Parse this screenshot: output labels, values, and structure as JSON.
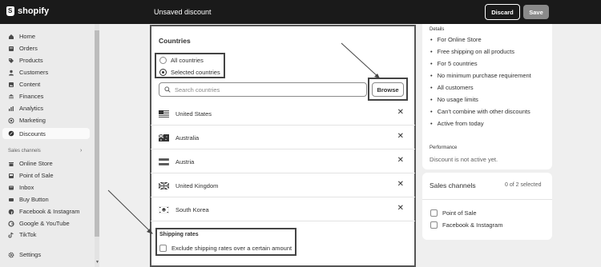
{
  "header": {
    "brand": "shopify",
    "page_title": "Unsaved discount",
    "discard_label": "Discard",
    "save_label": "Save"
  },
  "sidebar": {
    "items": [
      {
        "label": "Home",
        "icon": "home-icon"
      },
      {
        "label": "Orders",
        "icon": "orders-icon"
      },
      {
        "label": "Products",
        "icon": "tag-icon"
      },
      {
        "label": "Customers",
        "icon": "person-icon"
      },
      {
        "label": "Content",
        "icon": "content-icon"
      },
      {
        "label": "Finances",
        "icon": "bank-icon"
      },
      {
        "label": "Analytics",
        "icon": "analytics-icon"
      },
      {
        "label": "Marketing",
        "icon": "target-icon"
      },
      {
        "label": "Discounts",
        "icon": "discount-icon",
        "active": true
      }
    ],
    "channels_label": "Sales channels",
    "channels": [
      {
        "label": "Online Store",
        "icon": "store-icon"
      },
      {
        "label": "Point of Sale",
        "icon": "pos-icon"
      },
      {
        "label": "Inbox",
        "icon": "inbox-icon"
      },
      {
        "label": "Buy Button",
        "icon": "buy-button-icon"
      },
      {
        "label": "Facebook & Instagram",
        "icon": "facebook-icon"
      },
      {
        "label": "Google & YouTube",
        "icon": "google-icon"
      },
      {
        "label": "TikTok",
        "icon": "tiktok-icon"
      }
    ],
    "settings_label": "Settings"
  },
  "countries": {
    "title": "Countries",
    "radio_all": "All countries",
    "radio_selected": "Selected countries",
    "selected_option": "Selected countries",
    "search_placeholder": "Search countries",
    "browse_label": "Browse",
    "list": [
      {
        "name": "United States",
        "flag": "us-flag"
      },
      {
        "name": "Australia",
        "flag": "au-flag"
      },
      {
        "name": "Austria",
        "flag": "at-flag"
      },
      {
        "name": "United Kingdom",
        "flag": "gb-flag"
      },
      {
        "name": "South Korea",
        "flag": "kr-flag"
      }
    ],
    "remove_symbol": "✕"
  },
  "shipping_rates": {
    "title": "Shipping rates",
    "exclude_label": "Exclude shipping rates over a certain amount",
    "exclude_checked": false
  },
  "details": {
    "title": "Details",
    "items": [
      "For Online Store",
      "Free shipping on all products",
      "For 5 countries",
      "No minimum purchase requirement",
      "All customers",
      "No usage limits",
      "Can't combine with other discounts",
      "Active from today"
    ],
    "performance_title": "Performance",
    "performance_text": "Discount is not active yet."
  },
  "sales_channels": {
    "title": "Sales channels",
    "count": "0 of 2 selected",
    "options": [
      {
        "label": "Point of Sale",
        "checked": false
      },
      {
        "label": "Facebook & Instagram",
        "checked": false
      }
    ]
  },
  "colors": {
    "topbar": "#1a1a1a",
    "sidebar": "#ebebeb",
    "background": "#efefef",
    "card": "#ffffff",
    "annotation": "#444444"
  }
}
